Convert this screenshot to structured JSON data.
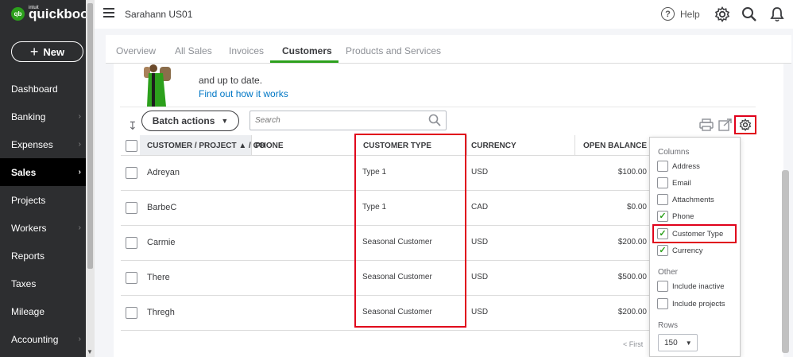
{
  "app": {
    "logo_brand": "quickbooks",
    "logo_intuit": "intuit",
    "logo_mark": "qb",
    "new_button": "New",
    "company_name": "Sarahann US01",
    "help_label": "Help"
  },
  "sidebar": {
    "items": [
      {
        "label": "Dashboard",
        "chevron": false
      },
      {
        "label": "Banking",
        "chevron": true
      },
      {
        "label": "Expenses",
        "chevron": true
      },
      {
        "label": "Sales",
        "chevron": true
      },
      {
        "label": "Projects",
        "chevron": false
      },
      {
        "label": "Workers",
        "chevron": true
      },
      {
        "label": "Reports",
        "chevron": false
      },
      {
        "label": "Taxes",
        "chevron": false
      },
      {
        "label": "Mileage",
        "chevron": false
      },
      {
        "label": "Accounting",
        "chevron": true
      }
    ],
    "active_item": "Sales"
  },
  "tabs": {
    "items": [
      "Overview",
      "All Sales",
      "Invoices",
      "Customers",
      "Products and Services"
    ],
    "active": "Customers"
  },
  "banner": {
    "text": "and up to date.",
    "link": "Find out how it works"
  },
  "toolbar": {
    "batch_actions": "Batch actions",
    "search_placeholder": "Search"
  },
  "table": {
    "headers": {
      "customer": "CUSTOMER / PROJECT ▲ / CO",
      "phone": "PHONE",
      "customer_type": "CUSTOMER TYPE",
      "currency": "CURRENCY",
      "open_balance": "OPEN BALANCE"
    },
    "rows": [
      {
        "name": "Adreyan",
        "phone": "",
        "customer_type": "Type 1",
        "currency": "USD",
        "balance": "$100.00"
      },
      {
        "name": "BarbeC",
        "phone": "",
        "customer_type": "Type 1",
        "currency": "CAD",
        "balance": "$0.00"
      },
      {
        "name": "Carmie",
        "phone": "",
        "customer_type": "Seasonal Customer",
        "currency": "USD",
        "balance": "$200.00"
      },
      {
        "name": "There",
        "phone": "",
        "customer_type": "Seasonal Customer",
        "currency": "USD",
        "balance": "$500.00"
      },
      {
        "name": "Thregh",
        "phone": "",
        "customer_type": "Seasonal Customer",
        "currency": "USD",
        "balance": "$200.00"
      }
    ],
    "pagination_first": "< First"
  },
  "column_settings": {
    "columns_heading": "Columns",
    "columns": [
      {
        "label": "Address",
        "checked": false
      },
      {
        "label": "Email",
        "checked": false
      },
      {
        "label": "Attachments",
        "checked": false
      },
      {
        "label": "Phone",
        "checked": true
      },
      {
        "label": "Customer Type",
        "checked": true
      },
      {
        "label": "Currency",
        "checked": true
      }
    ],
    "other_heading": "Other",
    "other": [
      {
        "label": "Include inactive",
        "checked": false
      },
      {
        "label": "Include projects",
        "checked": false
      }
    ],
    "rows_heading": "Rows",
    "rows_value": "150"
  },
  "colors": {
    "sidebar_bg": "#2d2e30",
    "accent_green": "#2ca01c",
    "link_blue": "#0077c5",
    "highlight_red": "#e0001b"
  }
}
